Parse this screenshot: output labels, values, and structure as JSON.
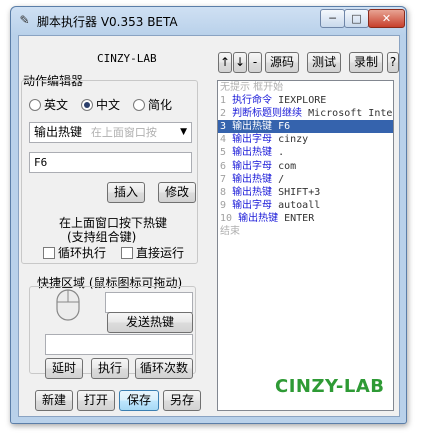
{
  "window": {
    "title": "脚本执行器 V0.353 BETA",
    "app_icon": "key-icon",
    "controls": {
      "minimize": "─",
      "maximize": "□",
      "close": "✕"
    }
  },
  "left": {
    "header": "CINZY-LAB",
    "editor_group_label": "动作编辑器",
    "radios": [
      {
        "label": "英文",
        "checked": false
      },
      {
        "label": "中文",
        "checked": true
      },
      {
        "label": "简化",
        "checked": false
      }
    ],
    "action_select": {
      "value": "输出热键",
      "hint": "在上面窗口按"
    },
    "value_input": "F6",
    "insert_button": "插入",
    "modify_button": "修改",
    "hotkey_hint_line1": "在上面窗口按下热键",
    "hotkey_hint_line2": "(支持组合键)",
    "loop_checkbox": {
      "label": "循环执行",
      "checked": false
    },
    "direct_run_checkbox": {
      "label": "直接运行",
      "checked": false
    },
    "quick_area_label": "快捷区域 (鼠标图标可拖动)",
    "quick_input_top": "",
    "send_hotkey_button": "发送热键",
    "quick_input_bottom": "",
    "delay_button": "延时",
    "execute_button": "执行",
    "loop_count_button": "循环次数",
    "new_button": "新建",
    "open_button": "打开",
    "save_button": "保存",
    "save_as_button": "另存"
  },
  "toolbar": {
    "up_button": "↑",
    "down_button": "↓",
    "separator": "-",
    "source_button": "源码",
    "test_button": "测试",
    "record_button": "录制",
    "help_button": "?"
  },
  "editor": {
    "header_hint": "无提示 框开始",
    "lines": [
      {
        "num": "1",
        "cmd": "执行命令",
        "arg": "IEXPLORE",
        "selected": false
      },
      {
        "num": "2",
        "cmd": "判断标题则继续",
        "arg": "Microsoft Inter",
        "selected": false
      },
      {
        "num": "3",
        "cmd": "输出热键",
        "arg": "F6",
        "selected": true
      },
      {
        "num": "4",
        "cmd": "输出字母",
        "arg": "cinzy",
        "selected": false
      },
      {
        "num": "5",
        "cmd": "输出热键",
        "arg": ".",
        "selected": false
      },
      {
        "num": "6",
        "cmd": "输出字母",
        "arg": "com",
        "selected": false
      },
      {
        "num": "7",
        "cmd": "输出热键",
        "arg": "/",
        "selected": false
      },
      {
        "num": "8",
        "cmd": "输出热键",
        "arg": "SHIFT+3",
        "selected": false
      },
      {
        "num": "9",
        "cmd": "输出字母",
        "arg": "autoall",
        "selected": false
      },
      {
        "num": "10",
        "cmd": "输出热键",
        "arg": "ENTER",
        "selected": false
      }
    ],
    "footer_hint": "结束",
    "brand": "CINZY-LAB"
  },
  "colors": {
    "selection": "#3563ad",
    "command_text": "#1a1ad8",
    "brand_green": "#2e9a35",
    "frame": "#b9d1ea"
  }
}
